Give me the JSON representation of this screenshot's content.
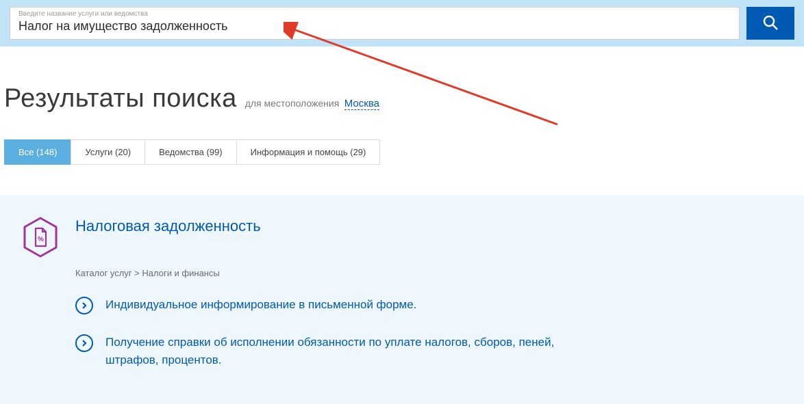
{
  "search": {
    "label": "Введите название услуги или ведомства",
    "value": "Налог на имущество задолженность"
  },
  "heading": {
    "title": "Результаты поиска",
    "subtitle": "для местоположения",
    "location": "Москва"
  },
  "tabs": [
    {
      "label": "Все (148)"
    },
    {
      "label": "Услуги (20)"
    },
    {
      "label": "Ведомства (99)"
    },
    {
      "label": "Информация и помощь (29)"
    }
  ],
  "result": {
    "title": "Налоговая задолженность",
    "breadcrumb": "Каталог услуг > Налоги и финансы",
    "items": [
      "Индивидуальное информирование в письменной форме.",
      "Получение справки об исполнении обязанности по уплате налогов, сборов, пеней, штрафов, процентов."
    ]
  }
}
